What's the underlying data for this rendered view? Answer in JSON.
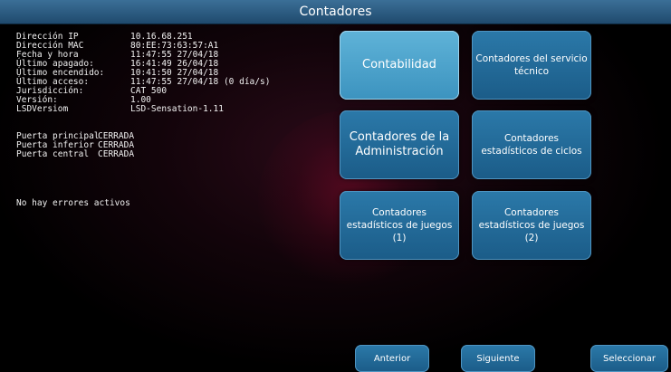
{
  "title": "Contadores",
  "info": [
    {
      "key": "Dirección IP",
      "value": "10.16.68.251"
    },
    {
      "key": "Dirección MAC",
      "value": "80:EE:73:63:57:A1"
    },
    {
      "key": "Fecha y hora",
      "value": "11:47:55 27/04/18"
    },
    {
      "key": "Último apagado:",
      "value": "16:41:49 26/04/18"
    },
    {
      "key": "Último encendido:",
      "value": "10:41:50 27/04/18"
    },
    {
      "key": "Último acceso:",
      "value": "11:47:55 27/04/18 (0 día/s)"
    },
    {
      "key": "Jurisdicción:",
      "value": "CAT 500"
    },
    {
      "key": "Versión:",
      "value": "1.00"
    },
    {
      "key": "LSDVersiom",
      "value": "LSD-Sensation-1.11"
    }
  ],
  "doors": [
    {
      "key": "Puerta principal",
      "value": "CERRADA"
    },
    {
      "key": "Puerta inferior",
      "value": "CERRADA"
    },
    {
      "key": "Puerta central",
      "value": "CERRADA"
    }
  ],
  "errors": "No hay errores activos",
  "tiles": {
    "contabilidad": "Contabilidad",
    "servicio_tecnico": "Contadores del servicio técnico",
    "administracion": "Contadores de la Administración",
    "ciclos": "Contadores estadísticos de ciclos",
    "juegos_1": "Contadores estadísticos de juegos (1)",
    "juegos_2": "Contadores estadísticos de juegos (2)"
  },
  "buttons": {
    "anterior": "Anterior",
    "siguiente": "Siguiente",
    "seleccionar": "Seleccionar"
  },
  "colors": {
    "title_bar": "#2d5d84",
    "tile": "#236a99",
    "tile_selected": "#4aa3cc",
    "background": "#000000"
  }
}
